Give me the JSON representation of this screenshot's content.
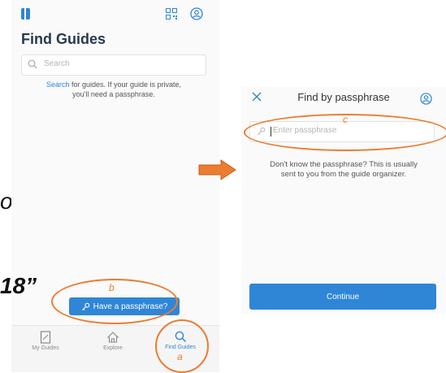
{
  "left_screen": {
    "title": "Find Guides",
    "search": {
      "placeholder": "Search"
    },
    "helper": {
      "link_text": "Search",
      "line1_rest": " for guides. If your guide is private,",
      "line2": "you'll need a passphrase."
    },
    "passphrase_button_label": "Have a passphrase?",
    "bottom_nav": {
      "items": [
        {
          "label": "My Guides",
          "icon": "book-icon"
        },
        {
          "label": "Explore",
          "icon": "house-icon"
        },
        {
          "label": "Find Guides",
          "icon": "search-icon",
          "active": true
        }
      ]
    }
  },
  "right_screen": {
    "title": "Find by passphrase",
    "passphrase_input": {
      "placeholder": "Enter passphrase"
    },
    "helper": {
      "line1": "Don't know the passphrase? This is usually",
      "line2": "sent to you from the guide organizer."
    },
    "continue_label": "Continue"
  },
  "annotations": {
    "a": "a",
    "b": "b",
    "c": "c",
    "bg_text_1": "om",
    "bg_text_2": "18”"
  },
  "colors": {
    "accent": "#2f86d6",
    "annotation": "#ec7c30"
  }
}
